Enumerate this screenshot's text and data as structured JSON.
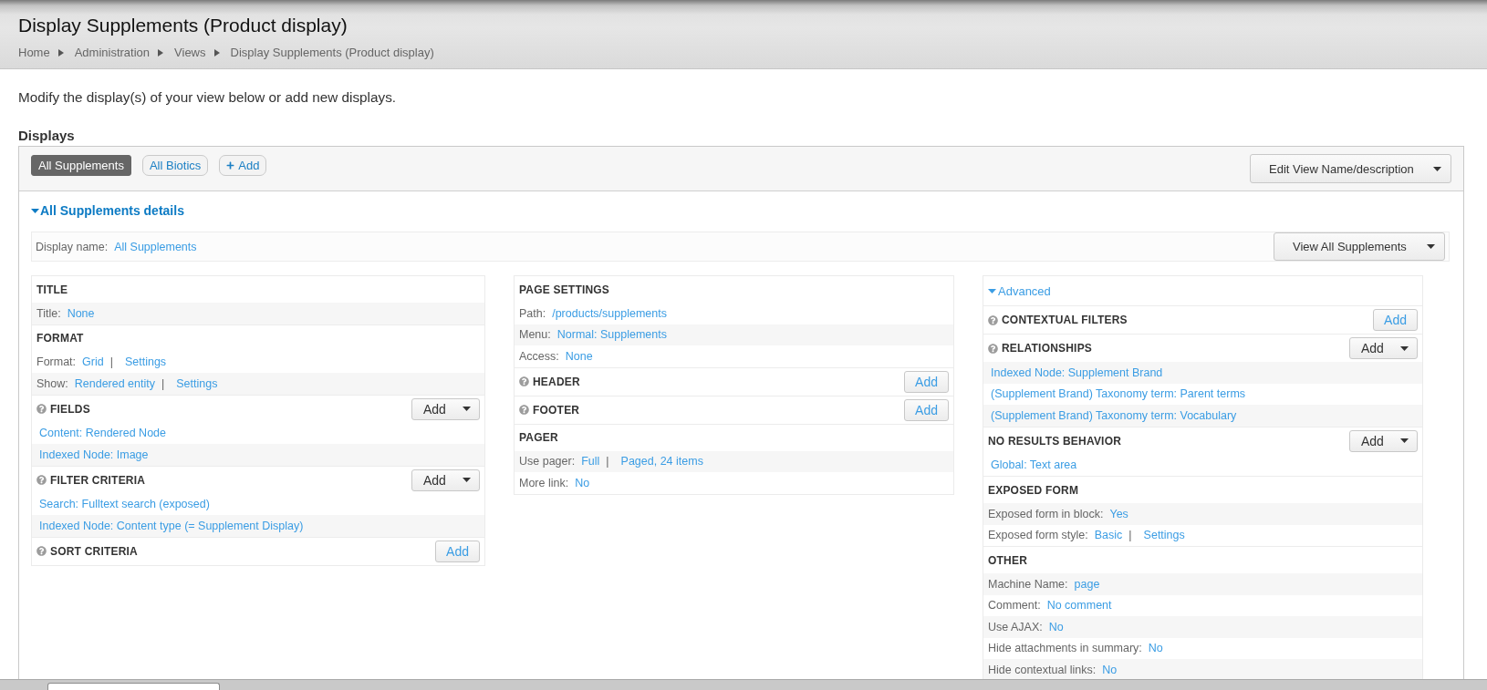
{
  "header": {
    "title": "Display Supplements (Product display)",
    "breadcrumb": [
      "Home",
      "Administration",
      "Views",
      "Display Supplements (Product display)"
    ]
  },
  "intro": "Modify the display(s) of your view below or add new displays.",
  "displays": {
    "heading": "Displays",
    "tabs": [
      {
        "label": "All Supplements",
        "selected": true
      },
      {
        "label": "All Biotics",
        "selected": false
      }
    ],
    "add_label": "Add",
    "edit_button": "Edit View Name/description"
  },
  "details": {
    "heading": "All Supplements details",
    "expanded": true,
    "display_name_label": "Display name:",
    "display_name": "All Supplements",
    "view_button": "View All Supplements"
  },
  "columns": [
    {
      "sections": [
        {
          "title": "TITLE",
          "help": false,
          "items": [
            {
              "kind": "setting",
              "label": "Title:",
              "values": [
                "None"
              ],
              "striped": true
            }
          ]
        },
        {
          "title": "FORMAT",
          "help": false,
          "items": [
            {
              "kind": "setting",
              "label": "Format:",
              "values": [
                "Grid",
                "Settings"
              ],
              "separator": "|",
              "striped": false
            },
            {
              "kind": "setting",
              "label": "Show:",
              "values": [
                "Rendered entity",
                "Settings"
              ],
              "separator": "|",
              "striped": true
            }
          ]
        },
        {
          "title": "FIELDS",
          "help": true,
          "add": {
            "kind": "dropdown",
            "label": "Add"
          },
          "items": [
            {
              "kind": "link",
              "text": "Content: Rendered Node",
              "striped": false
            },
            {
              "kind": "link",
              "text": "Indexed Node: Image",
              "striped": true
            }
          ]
        },
        {
          "title": "FILTER CRITERIA",
          "help": true,
          "add": {
            "kind": "dropdown",
            "label": "Add"
          },
          "items": [
            {
              "kind": "link",
              "text": "Search: Fulltext search (exposed)",
              "striped": false
            },
            {
              "kind": "link",
              "text": "Indexed Node: Content type (= Supplement Display)",
              "striped": true
            }
          ]
        },
        {
          "title": "SORT CRITERIA",
          "help": true,
          "add": {
            "kind": "plain",
            "label": "Add"
          }
        }
      ]
    },
    {
      "sections": [
        {
          "title": "PAGE SETTINGS",
          "help": false,
          "items": [
            {
              "kind": "setting",
              "label": "Path:",
              "values": [
                "/products/supplements"
              ],
              "striped": false
            },
            {
              "kind": "setting",
              "label": "Menu:",
              "values": [
                "Normal: Supplements"
              ],
              "striped": true
            },
            {
              "kind": "setting",
              "label": "Access:",
              "values": [
                "None"
              ],
              "striped": false
            }
          ]
        },
        {
          "title": "HEADER",
          "help": true,
          "add": {
            "kind": "plain",
            "label": "Add"
          }
        },
        {
          "title": "FOOTER",
          "help": true,
          "add": {
            "kind": "plain",
            "label": "Add"
          }
        },
        {
          "title": "PAGER",
          "help": false,
          "items": [
            {
              "kind": "setting",
              "label": "Use pager:",
              "values": [
                "Full",
                "Paged, 24 items"
              ],
              "separator": "|",
              "striped": true
            },
            {
              "kind": "setting",
              "label": "More link:",
              "values": [
                "No"
              ],
              "striped": false
            }
          ]
        }
      ]
    },
    {
      "toggle": {
        "label": "Advanced",
        "expanded": true
      },
      "sections": [
        {
          "title": "CONTEXTUAL FILTERS",
          "help": true,
          "add": {
            "kind": "plain",
            "label": "Add"
          }
        },
        {
          "title": "RELATIONSHIPS",
          "help": true,
          "add": {
            "kind": "dropdown",
            "label": "Add"
          },
          "items": [
            {
              "kind": "link",
              "text": "Indexed Node: Supplement Brand",
              "striped": true
            },
            {
              "kind": "link",
              "text": "(Supplement Brand) Taxonomy term: Parent terms",
              "striped": false
            },
            {
              "kind": "link",
              "text": "(Supplement Brand) Taxonomy term: Vocabulary",
              "striped": true
            }
          ]
        },
        {
          "title": "NO RESULTS BEHAVIOR",
          "help": false,
          "add": {
            "kind": "dropdown",
            "label": "Add"
          },
          "items": [
            {
              "kind": "link",
              "text": "Global: Text area",
              "striped": false
            }
          ]
        },
        {
          "title": "EXPOSED FORM",
          "help": false,
          "items": [
            {
              "kind": "setting",
              "label": "Exposed form in block:",
              "values": [
                "Yes"
              ],
              "striped": true
            },
            {
              "kind": "setting",
              "label": "Exposed form style:",
              "values": [
                "Basic",
                "Settings"
              ],
              "separator": "|",
              "striped": false
            }
          ]
        },
        {
          "title": "OTHER",
          "help": false,
          "items": [
            {
              "kind": "setting",
              "label": "Machine Name:",
              "values": [
                "page"
              ],
              "striped": true
            },
            {
              "kind": "setting",
              "label": "Comment:",
              "values": [
                "No comment"
              ],
              "striped": false
            },
            {
              "kind": "setting",
              "label": "Use AJAX:",
              "values": [
                "No"
              ],
              "striped": true
            },
            {
              "kind": "setting",
              "label": "Hide attachments in summary:",
              "values": [
                "No"
              ],
              "striped": false
            },
            {
              "kind": "setting",
              "label": "Hide contextual links:",
              "values": [
                "No"
              ],
              "striped": true
            }
          ]
        }
      ]
    }
  ]
}
